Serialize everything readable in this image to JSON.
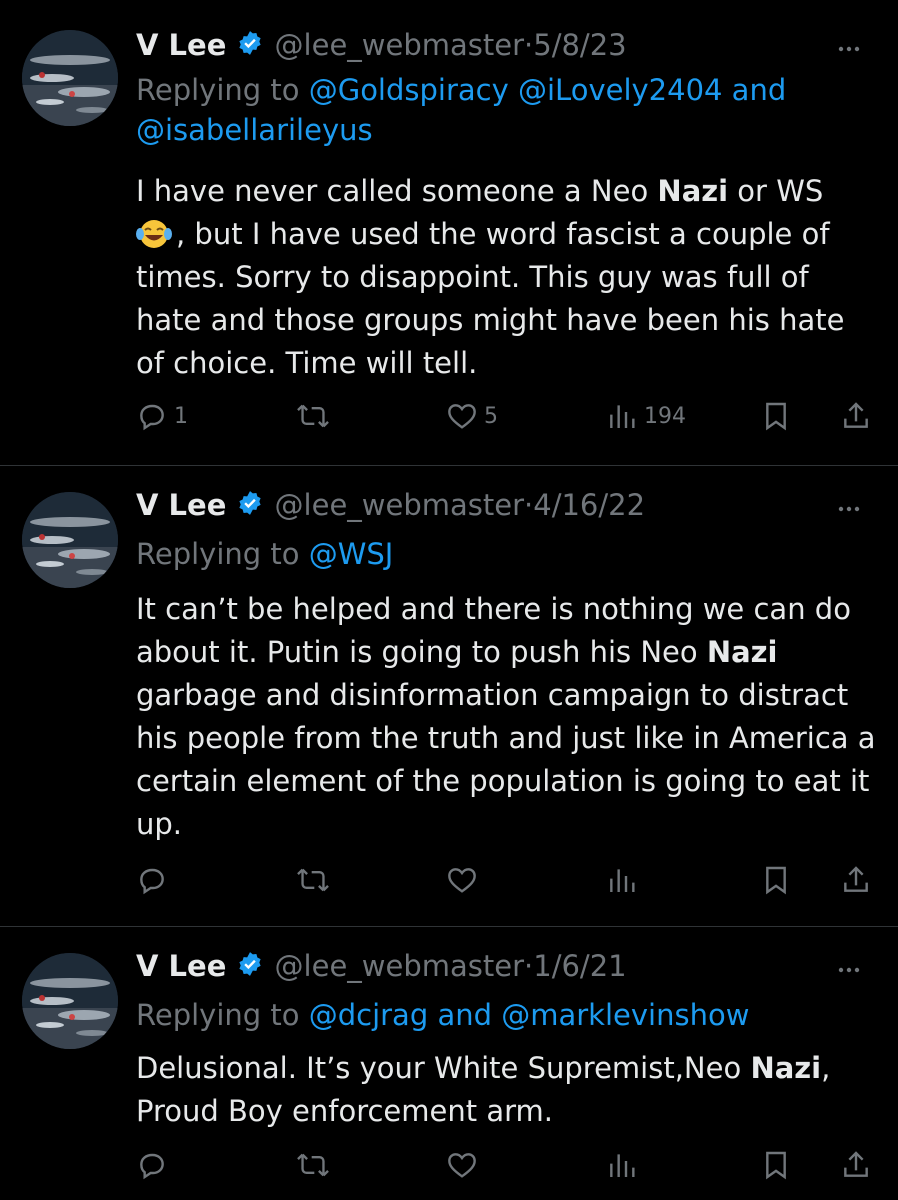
{
  "tweets": [
    {
      "name": "V Lee",
      "handle": "@lee_webmaster",
      "sep": "·",
      "date": "5/8/23",
      "replying_prefix": "Replying to",
      "reply_line1": "@Goldspiracy @iLovely2404 and",
      "reply_line2": "@isabellarileyus",
      "body_a": "I have never called someone a Neo ",
      "body_bold": "Nazi",
      "body_b": " or WS",
      "emoji": "😂",
      "body_c": ", but I have used the word fascist a couple of times. Sorry to disappoint. This guy was full of hate and those groups might have been his hate of choice. Time will tell.",
      "replies": "1",
      "likes": "5",
      "views": "194"
    },
    {
      "name": "V Lee",
      "handle": "@lee_webmaster",
      "sep": "·",
      "date": "4/16/22",
      "replying_prefix": "Replying to",
      "reply_line1": "@WSJ",
      "body_a": "It can’t be helped and there is nothing we can do about it. Putin is going to push his Neo ",
      "body_bold": "Nazi",
      "body_b": " garbage and disinformation campaign to distract his people from the truth and just like in America a certain element of the population is going to eat it up."
    },
    {
      "name": "V Lee",
      "handle": "@lee_webmaster",
      "sep": "·",
      "date": "1/6/21",
      "replying_prefix": "Replying to",
      "reply_line1": "@dcjrag and @marklevinshow",
      "body_a": "Delusional. It’s your White Supremist,Neo ",
      "body_bold": "Nazi",
      "body_b": ", Proud Boy enforcement arm."
    }
  ],
  "icons": {
    "reply": "reply-icon",
    "retweet": "retweet-icon",
    "like": "like-icon",
    "views": "views-icon",
    "bookmark": "bookmark-icon",
    "share": "share-icon",
    "verified": "verified-badge-icon",
    "more": "more-icon"
  },
  "colors": {
    "background": "#000000",
    "text": "#e7e9ea",
    "muted": "#71767b",
    "link": "#1d9bf0",
    "verified": "#1d9bf0"
  }
}
